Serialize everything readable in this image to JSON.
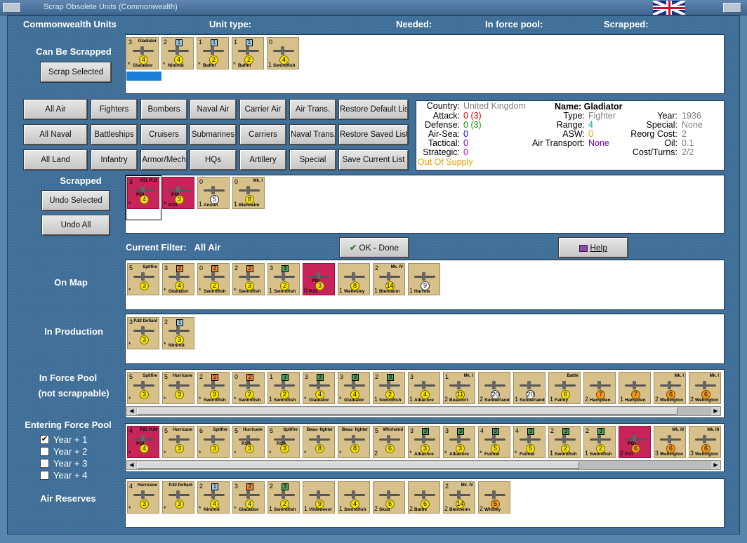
{
  "window": {
    "title": "Scrap Obsolete Units (Commonwealth)"
  },
  "header": {
    "units": "Commonwealth Units",
    "unit_type": "Unit type:",
    "needed": "Needed:",
    "in_force_pool": "In force pool:",
    "scrapped": "Scrapped:"
  },
  "can_be_scrapped": {
    "label": "Can Be Scrapped",
    "button": "Scrap Selected",
    "counters": [
      {
        "name": "Gladiator",
        "tl": "3",
        "bl": "*",
        "disc": "4",
        "tr": "Gladiator"
      },
      {
        "name": "Nimrod",
        "tl": "2",
        "bl": "*",
        "disc": "4",
        "box": "1",
        "box_color": "blue"
      },
      {
        "name": "Baffin",
        "tl": "1",
        "bl": "*",
        "disc": "2",
        "box": "1",
        "box_color": "blue"
      },
      {
        "name": "Baffin",
        "tl": "1",
        "bl": "*",
        "disc": "2",
        "box": "1",
        "box_color": "blue"
      },
      {
        "name": "Swordfish",
        "tl": "0",
        "bl": "1",
        "disc": "4"
      }
    ]
  },
  "filter_buttons": [
    [
      "All Air",
      "Fighters",
      "Bombers",
      "Naval Air",
      "Carrier Air",
      "Air Trans.",
      "Restore Default List"
    ],
    [
      "All Naval",
      "Battleships",
      "Cruisers",
      "Submarines",
      "Carriers",
      "Naval Trans.",
      "Restore Saved List"
    ],
    [
      "All Land",
      "Infantry",
      "Armor/Mech",
      "HQs",
      "Artillery",
      "Special",
      "Save Current List"
    ]
  ],
  "info": {
    "country_l": "Country:",
    "country": "United Kingdom",
    "attack_l": "Attack:",
    "attack": "0",
    "attack2": "(3)",
    "defense_l": "Defense:",
    "defense": "0",
    "defense2": "(3)",
    "airsea_l": "Air-Sea:",
    "airsea": "0",
    "tactical_l": "Tactical:",
    "tactical": "0",
    "strategic_l": "Strategic:",
    "strategic": "0",
    "supply": "Out Of Supply",
    "name": "Name: Gladiator",
    "type_l": "Type:",
    "type": "Fighter",
    "range_l": "Range:",
    "range": "4",
    "asw_l": "ASW:",
    "asw": "0",
    "airtrans_l": "Air Transport:",
    "airtrans": "None",
    "year_l": "Year:",
    "year": "1936",
    "special_l": "Special:",
    "special": "None",
    "reorg_l": "Reorg Cost:",
    "reorg": "2",
    "oil_l": "Oil:",
    "oil": "0.1",
    "cost_l": "Cost/Turns:",
    "cost": "2/2"
  },
  "scrapped": {
    "label": "Scrapped",
    "undo_selected": "Undo Selected",
    "undo_all": "Undo All",
    "counters": [
      {
        "name": "",
        "tl": "3",
        "bl": "*",
        "disc": "4",
        "tr": "PZL P.11",
        "red": true,
        "flag": "POL"
      },
      {
        "name": "P.23",
        "tl": "",
        "bl": "*",
        "disc": "3",
        "red": true,
        "flag": "POL"
      },
      {
        "name": "Anson",
        "tl": "0",
        "bl": "1",
        "disc": "5",
        "disc_color": "w"
      },
      {
        "name": "Blenheim",
        "tl": "0",
        "bl": "1",
        "disc": "8",
        "tr": "Mk. I"
      }
    ]
  },
  "current_filter": {
    "label": "Current Filter:",
    "value": "All Air"
  },
  "ok_button": "OK - Done",
  "help_button": "Help",
  "on_map": {
    "label": "On Map",
    "counters": [
      {
        "name": "",
        "tl": "5",
        "bl": "*",
        "disc": "3",
        "tr": "Spitfire"
      },
      {
        "name": "Gladiator",
        "tl": "3",
        "bl": "*",
        "disc": "4",
        "box": "2",
        "box_color": "orange"
      },
      {
        "name": "Swordfish",
        "tl": "0",
        "bl": "*",
        "disc": "2",
        "box": "2",
        "box_color": "orange"
      },
      {
        "name": "Swordfish",
        "tl": "2",
        "bl": "*",
        "disc": "3",
        "box": "2",
        "box_color": "orange"
      },
      {
        "name": "Swordfish",
        "tl": "3",
        "bl": "1",
        "disc": "2",
        "box": "3",
        "box_color": "green"
      },
      {
        "name": "P.23",
        "tl": "",
        "bl": "0",
        "disc": "3",
        "red": true,
        "flag": "POL"
      },
      {
        "name": "Wellesley",
        "tl": "",
        "bl": "1",
        "disc": "8"
      },
      {
        "name": "Blenheim",
        "tl": "2",
        "bl": "1",
        "disc": "14",
        "tr": "Mk. IV"
      },
      {
        "name": "Harrow",
        "tl": "",
        "bl": "1",
        "disc": "9",
        "disc_color": "w"
      }
    ]
  },
  "in_production": {
    "label": "In Production",
    "counters": [
      {
        "name": "",
        "tl": "3",
        "bl": "*",
        "disc": "3",
        "tr": "P.82 Defiant"
      },
      {
        "name": "Nimrod",
        "tl": "2",
        "bl": "*",
        "disc": "3",
        "box": "1",
        "box_color": "blue"
      }
    ]
  },
  "in_force_pool": {
    "label": "In Force Pool",
    "sub": "(not scrappable)",
    "counters": [
      {
        "name": "",
        "tl": "5",
        "bl": "*",
        "disc": "3",
        "tr": "Spitfire"
      },
      {
        "name": "",
        "tl": "5",
        "bl": "*",
        "disc": "3",
        "tr": "Hurricane"
      },
      {
        "name": "Swordfish",
        "tl": "2",
        "bl": "*",
        "disc": "3",
        "box": "2",
        "box_color": "orange"
      },
      {
        "name": "Swordfish",
        "tl": "0",
        "bl": "*",
        "disc": "2",
        "box": "2",
        "box_color": "orange"
      },
      {
        "name": "Swordfish",
        "tl": "1",
        "bl": "1",
        "disc": "2",
        "box": "3",
        "box_color": "green"
      },
      {
        "name": "Gladiator",
        "tl": "3",
        "bl": "*",
        "disc": "4",
        "box": "3",
        "box_color": "green"
      },
      {
        "name": "Gladiator",
        "tl": "3",
        "bl": "*",
        "disc": "4",
        "box": "3",
        "box_color": "green"
      },
      {
        "name": "Swordfish",
        "tl": "2",
        "bl": "1",
        "disc": "2",
        "box": "3",
        "box_color": "green"
      },
      {
        "name": "Albacore",
        "tl": "3",
        "bl": "1",
        "disc": "4"
      },
      {
        "name": "Beaufort",
        "tl": "1",
        "bl": "2",
        "disc": "11",
        "tr": "Mk. I"
      },
      {
        "name": "Sunderland",
        "tl": "",
        "bl": "2",
        "disc": "20",
        "disc_color": "w"
      },
      {
        "name": "Sunderland",
        "tl": "",
        "bl": "1",
        "disc": "20",
        "disc_color": "w"
      },
      {
        "name": "Fairey",
        "tl": "",
        "bl": "1",
        "disc": "6",
        "tr": "Battle"
      },
      {
        "name": "Hampden",
        "tl": "",
        "bl": "2",
        "disc": "7",
        "disc_color": "o"
      },
      {
        "name": "Hampden",
        "tl": "",
        "bl": "1",
        "disc": "7",
        "disc_color": "o"
      },
      {
        "name": "Wellington",
        "tl": "",
        "bl": "2",
        "disc": "6",
        "tr": "Mk. I",
        "disc_color": "o"
      },
      {
        "name": "Wellington",
        "tl": "",
        "bl": "2",
        "disc": "6",
        "tr": "Mk. I",
        "disc_color": "o"
      }
    ]
  },
  "entering_force_pool": {
    "label": "Entering Force Pool",
    "years": [
      {
        "label": "Year + 1",
        "checked": true
      },
      {
        "label": "Year + 2",
        "checked": false
      },
      {
        "label": "Year + 3",
        "checked": false
      },
      {
        "label": "Year + 4",
        "checked": false
      }
    ],
    "counters": [
      {
        "name": "",
        "tl": "4",
        "bl": "*",
        "disc": "4",
        "tr": "PZL P.24",
        "red": true,
        "flag": "POL"
      },
      {
        "name": "",
        "tl": "5",
        "bl": "*",
        "disc": "3",
        "tr": "Hurricane"
      },
      {
        "name": "",
        "tl": "6",
        "bl": "*",
        "disc": "3",
        "tr": "Spitfire"
      },
      {
        "name": "",
        "tl": "5",
        "bl": "*",
        "disc": "3",
        "tr": "Hurricane",
        "flag": "RSA"
      },
      {
        "name": "",
        "tl": "5",
        "bl": "*",
        "disc": "3",
        "tr": "Spitfire",
        "flag": "RSA"
      },
      {
        "name": "",
        "tl": "",
        "bl": "*",
        "disc": "8",
        "tr": "Beau- fighter"
      },
      {
        "name": "",
        "tl": "",
        "bl": "*",
        "disc": "8",
        "tr": "Beau- fighter"
      },
      {
        "name": "",
        "tl": "5",
        "bl": "2",
        "disc": "6",
        "tr": "Whirlwind"
      },
      {
        "name": "Albacore",
        "tl": "3",
        "bl": "*",
        "disc": "3",
        "box": "3",
        "box_color": "green"
      },
      {
        "name": "Albacore",
        "tl": "3",
        "bl": "*",
        "disc": "3",
        "box": "3",
        "box_color": "green"
      },
      {
        "name": "Fulmar",
        "tl": "4",
        "bl": "*",
        "disc": "5",
        "box": "3",
        "box_color": "green"
      },
      {
        "name": "Fulmar",
        "tl": "4",
        "bl": "*",
        "disc": "5",
        "box": "3",
        "box_color": "green"
      },
      {
        "name": "Swordfish",
        "tl": "2",
        "bl": "1",
        "disc": "2",
        "box": "3",
        "box_color": "green"
      },
      {
        "name": "Swordfish",
        "tl": "2",
        "bl": "1",
        "disc": "2",
        "box": "3",
        "box_color": "green"
      },
      {
        "name": "P.37",
        "tl": "",
        "bl": "2",
        "disc": "6",
        "red": true,
        "flag": "POL",
        "disc_color": "o"
      },
      {
        "name": "Wellington",
        "tl": "",
        "bl": "3",
        "disc": "6",
        "tr": "Mk. III",
        "disc_color": "o"
      },
      {
        "name": "Wellington",
        "tl": "",
        "bl": "3",
        "disc": "6",
        "tr": "Mk. III",
        "disc_color": "o"
      }
    ]
  },
  "air_reserves": {
    "label": "Air Reserves",
    "counters": [
      {
        "name": "",
        "tl": "4",
        "bl": "*",
        "disc": "3",
        "tr": "Hurricane"
      },
      {
        "name": "",
        "tl": "",
        "bl": "*",
        "disc": "3",
        "tr": "P.82 Defiant"
      },
      {
        "name": "Nimrod",
        "tl": "2",
        "bl": "*",
        "disc": "4",
        "box": "1",
        "box_color": "blue"
      },
      {
        "name": "Gladiator",
        "tl": "3",
        "bl": "*",
        "disc": "4",
        "box": "2",
        "box_color": "orange"
      },
      {
        "name": "Swordfish",
        "tl": "2",
        "bl": "1",
        "disc": "2",
        "box": "3",
        "box_color": "green"
      },
      {
        "name": "Vildebeest",
        "tl": "",
        "bl": "1",
        "disc": "9"
      },
      {
        "name": "Swordfish",
        "tl": "",
        "bl": "1",
        "disc": "4"
      },
      {
        "name": "Skua",
        "tl": "",
        "bl": "2",
        "disc": "6"
      },
      {
        "name": "Battle",
        "tl": "",
        "bl": "2",
        "disc": "6"
      },
      {
        "name": "Blenheim",
        "tl": "2",
        "bl": "2",
        "disc": "14",
        "tr": "Mk. IV"
      },
      {
        "name": "Whitley",
        "tl": "",
        "bl": "2",
        "disc": "5",
        "disc_color": "o"
      }
    ]
  },
  "colors": {
    "panel_bg": "#3f6f98",
    "counter": "#d7c08a",
    "counter_red": "#c8245a",
    "label": "#ffffff",
    "info_gray": "#808080",
    "red": "#e00000",
    "green": "#00a000",
    "blue": "#0000d0",
    "orange": "#e8a000",
    "magenta": "#e000e0",
    "purple": "#7a00c8"
  }
}
